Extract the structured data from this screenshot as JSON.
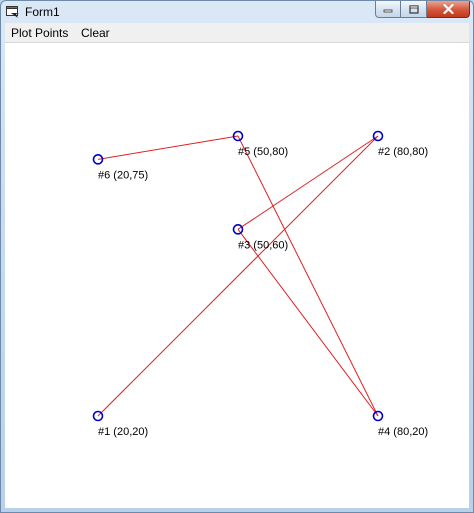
{
  "window": {
    "title": "Form1"
  },
  "menu": {
    "items": [
      "Plot Points",
      "Clear"
    ]
  },
  "plot": {
    "points": [
      {
        "label": "#1 (20,20)",
        "x": 20,
        "y": 20
      },
      {
        "label": "#2 (80,80)",
        "x": 80,
        "y": 80
      },
      {
        "label": "#3 (50,60)",
        "x": 50,
        "y": 60
      },
      {
        "label": "#4 (80,20)",
        "x": 80,
        "y": 20
      },
      {
        "label": "#5 (50,80)",
        "x": 50,
        "y": 80
      },
      {
        "label": "#6 (20,75)",
        "x": 20,
        "y": 75
      }
    ],
    "path_order": [
      1,
      2,
      3,
      4,
      5,
      6
    ],
    "line_color": "#e02020",
    "marker_color": "#0000cc"
  }
}
